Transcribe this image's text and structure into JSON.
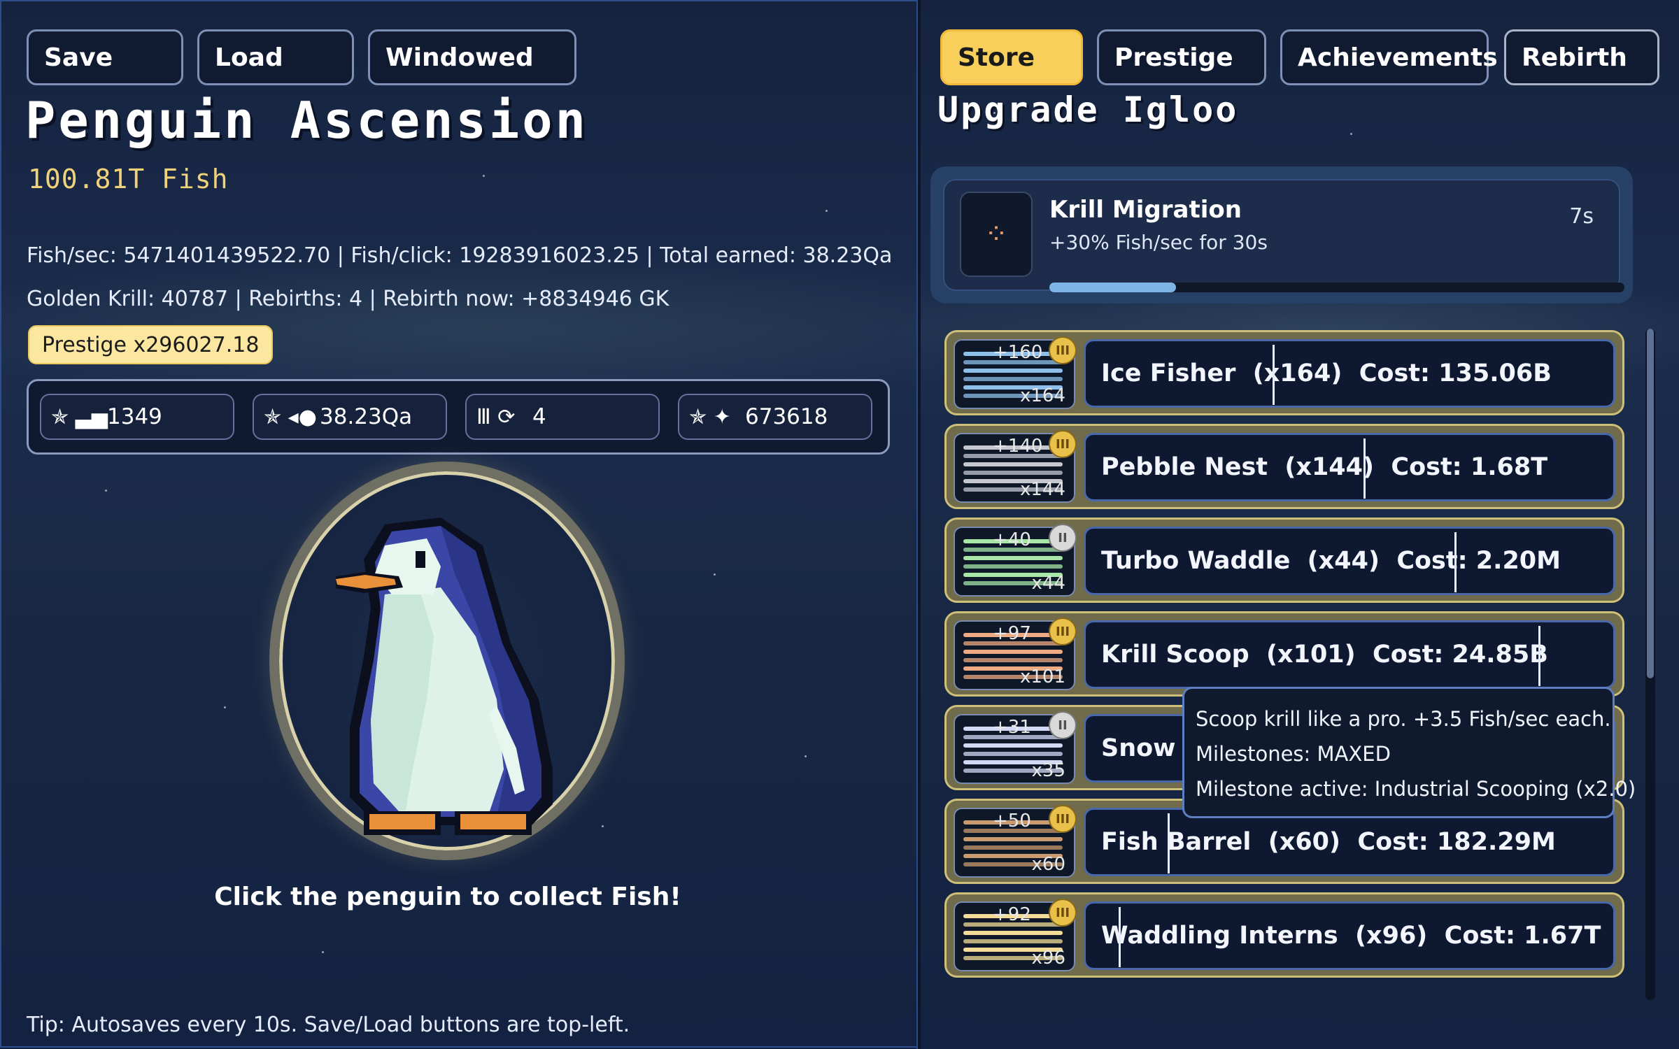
{
  "top_buttons_left": [
    "Save",
    "Load",
    "Windowed"
  ],
  "top_buttons_right": [
    "Store",
    "Prestige",
    "Achievements",
    "Rebirth"
  ],
  "active_tab": "Store",
  "game": {
    "title": "Penguin Ascension",
    "fish": "100.81T Fish",
    "stats_line1": "Fish/sec: 5471401439522.70  |  Fish/click: 19283916023.25  |  Total earned: 38.23Qa",
    "stats_line2": "Golden Krill: 40787  |  Rebirths: 4  |  Rebirth now: +8834946 GK",
    "prestige_badge": "Prestige x296027.18",
    "collect_hint": "Click the penguin to collect Fish!",
    "tip": "Tip: Autosaves every 10s. Save/Load buttons are top-left."
  },
  "stat_chips": [
    {
      "icon": "✯ ▃▅",
      "icon_name": "upgrades-icon",
      "value": "1349"
    },
    {
      "icon": "✯ ◂●",
      "icon_name": "fish-icon",
      "value": "38.23Qa"
    },
    {
      "icon": "Ⅲ ⟳",
      "icon_name": "rebirth-icon",
      "value": "4"
    },
    {
      "icon": "✯ ✦",
      "icon_name": "krill-icon",
      "value": "673618"
    }
  ],
  "store": {
    "title": "Upgrade Igloo",
    "event": {
      "name": "Krill Migration",
      "description": "+30% Fish/sec for 30s",
      "timer": "7s",
      "progress": 0.22
    },
    "upgrades": [
      {
        "name": "Ice Fisher",
        "owned": "x164",
        "cost": "135.06B",
        "label": "Ice Fisher  (x164)  Cost: 135.06B",
        "plus": "+160",
        "count": "x164",
        "color": "#8fc0ec",
        "badge": "III",
        "badge_type": "gold"
      },
      {
        "name": "Pebble Nest",
        "owned": "x144",
        "cost": "1.68T",
        "label": "Pebble Nest  (x144)  Cost: 1.68T",
        "plus": "+140",
        "count": "x144",
        "color": "#c5c7cf",
        "badge": "III",
        "badge_type": "gold"
      },
      {
        "name": "Turbo Waddle",
        "owned": "x44",
        "cost": "2.20M",
        "label": "Turbo Waddle  (x44)  Cost: 2.20M",
        "plus": "+40",
        "count": "x44",
        "color": "#a6e6a6",
        "badge": "II",
        "badge_type": "silver"
      },
      {
        "name": "Krill Scoop",
        "owned": "x101",
        "cost": "24.85B",
        "label": "Krill Scoop  (x101)  Cost: 24.85B",
        "plus": "+97",
        "count": "x101",
        "color": "#eeaa82",
        "badge": "III",
        "badge_type": "gold"
      },
      {
        "name": "Snow D",
        "owned": "",
        "cost": "",
        "label": "Snow D",
        "plus": "+31",
        "count": "x35",
        "color": "#d4d8f4",
        "badge": "II",
        "badge_type": "silver"
      },
      {
        "name": "Fish Barrel",
        "owned": "x60",
        "cost": "182.29M",
        "label": "Fish Barrel  (x60)  Cost: 182.29M",
        "plus": "+50",
        "count": "x60",
        "color": "#c99a6e",
        "badge": "III",
        "badge_type": "gold"
      },
      {
        "name": "Waddling Interns",
        "owned": "x96",
        "cost": "1.67T",
        "label": "Waddling Interns  (x96)  Cost: 1.67T",
        "plus": "+92",
        "count": "x96",
        "color": "#f4dc98",
        "badge": "III",
        "badge_type": "gold"
      }
    ],
    "tooltip": [
      "Scoop krill like a pro. +3.5 Fish/sec each.",
      "Milestones: MAXED",
      "Milestone active: Industrial Scooping (x2.0)"
    ]
  }
}
